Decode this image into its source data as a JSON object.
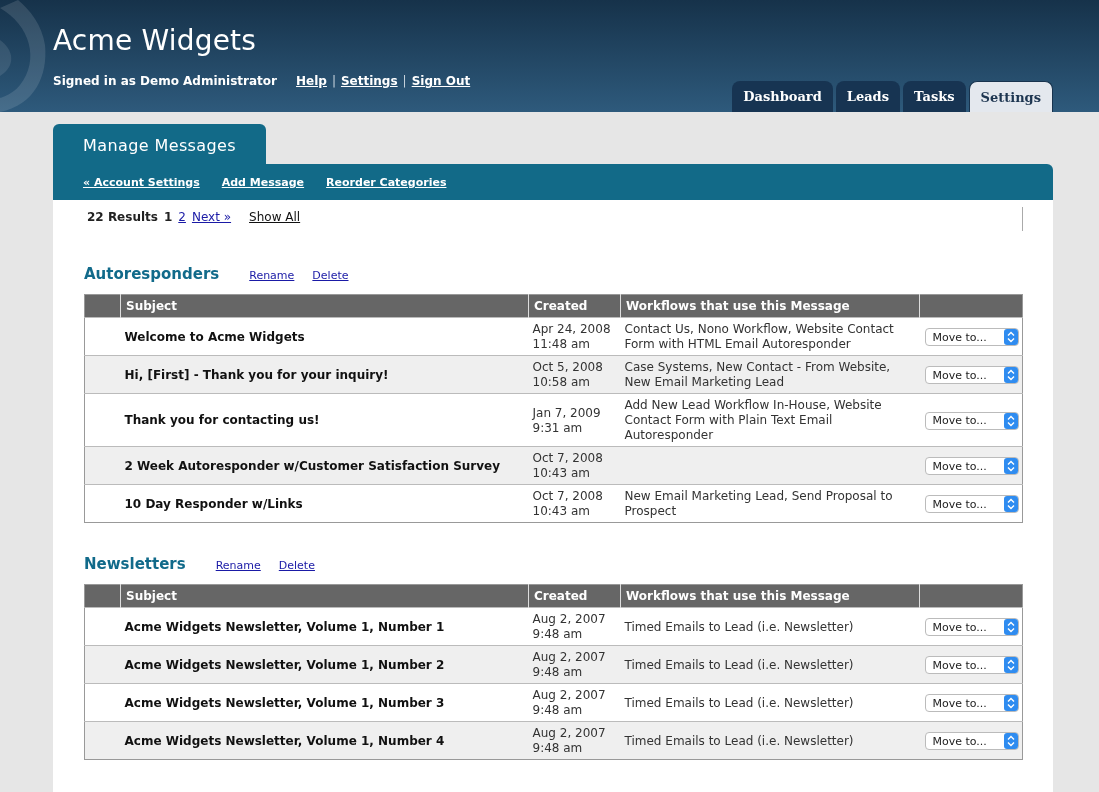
{
  "header": {
    "title": "Acme Widgets",
    "signed_in": "Signed in as Demo Administrator",
    "links": [
      {
        "kind": "link",
        "text": "Help"
      },
      {
        "kind": "separator",
        "text": "|"
      },
      {
        "kind": "link",
        "text": "Settings"
      },
      {
        "kind": "separator",
        "text": "|"
      },
      {
        "kind": "link",
        "text": "Sign Out"
      }
    ]
  },
  "nav_tabs": [
    {
      "label": "Dashboard",
      "selected": false
    },
    {
      "label": "Leads",
      "selected": false
    },
    {
      "label": "Tasks",
      "selected": false
    },
    {
      "label": "Settings",
      "selected": true
    }
  ],
  "panel": {
    "title": "Manage Messages",
    "actions": [
      "« Account Settings",
      "Add Message",
      "Reorder Categories"
    ]
  },
  "pagination": {
    "results": "22 Results",
    "pages": [
      {
        "label": "1",
        "selected": true
      },
      {
        "label": "2",
        "selected": false
      }
    ],
    "next": "Next »",
    "show_all": "Show All"
  },
  "categories": [
    {
      "name": "Autoresponders",
      "actions": [
        "Rename",
        "Delete"
      ],
      "columns": [
        "Subject",
        "Created",
        "Workflows that use this Message"
      ],
      "rows": [
        {
          "subject": "Welcome to Acme Widgets",
          "date": "Apr 24, 2008",
          "time": "11:48 am",
          "workflows": "Contact Us, Nono Workflow, Website Contact Form with HTML Email Autoresponder",
          "move": "Move to..."
        },
        {
          "subject": "Hi, [First] - Thank you for your inquiry!",
          "date": "Oct 5, 2008",
          "time": "10:58 am",
          "workflows": "Case Systems, New Contact - From Website, New Email Marketing Lead",
          "move": "Move to..."
        },
        {
          "subject": "Thank you for contacting us!",
          "date": "Jan 7, 2009",
          "time": "9:31 am",
          "workflows": "Add New Lead Workflow In-House, Website Contact Form with Plain Text Email Autoresponder",
          "move": "Move to..."
        },
        {
          "subject": "2 Week Autoresponder w/Customer Satisfaction Survey",
          "date": "Oct 7, 2008",
          "time": "10:43 am",
          "move": "Move to..."
        },
        {
          "subject": "10 Day Responder w/Links",
          "date": "Oct 7, 2008",
          "time": "10:43 am",
          "workflows": "New Email Marketing Lead, Send Proposal to Prospect",
          "move": "Move to..."
        }
      ]
    },
    {
      "name": "Newsletters",
      "actions": [
        "Rename",
        "Delete"
      ],
      "columns": [
        "Subject",
        "Created",
        "Workflows that use this Message"
      ],
      "rows": [
        {
          "subject": "Acme Widgets Newsletter, Volume 1, Number 1",
          "date": "Aug 2, 2007",
          "time": "9:48 am",
          "workflows": "Timed Emails to Lead (i.e. Newsletter)",
          "move": "Move to..."
        },
        {
          "subject": "Acme Widgets Newsletter, Volume 1, Number 2",
          "date": "Aug 2, 2007",
          "time": "9:48 am",
          "workflows": "Timed Emails to Lead (i.e. Newsletter)",
          "move": "Move to..."
        },
        {
          "subject": "Acme Widgets Newsletter, Volume 1, Number 3",
          "date": "Aug 2, 2007",
          "time": "9:48 am",
          "workflows": "Timed Emails to Lead (i.e. Newsletter)",
          "move": "Move to..."
        },
        {
          "subject": "Acme Widgets Newsletter, Volume 1, Number 4",
          "date": "Aug 2, 2007",
          "time": "9:48 am",
          "workflows": "Timed Emails to Lead (i.e. Newsletter)",
          "move": "Move to..."
        }
      ]
    }
  ]
}
